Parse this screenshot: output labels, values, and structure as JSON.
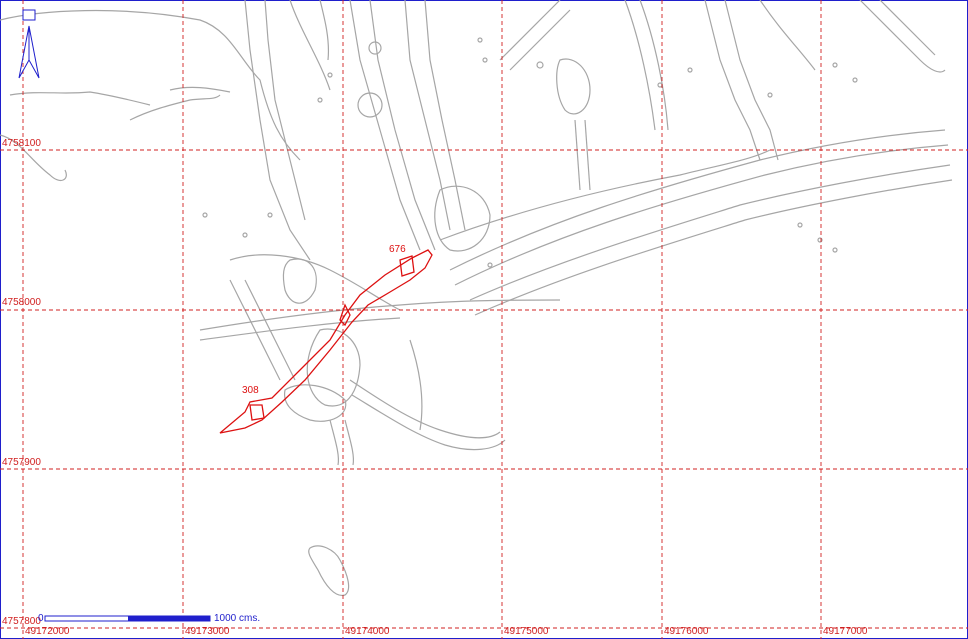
{
  "colors": {
    "grid": "#d02020",
    "feature": "#a6a6a6",
    "highlight": "#dd1111",
    "north_arrow": "#1f1fcc",
    "scale_bar": "#1f1fcc",
    "frame": "#1f1fcc"
  },
  "grid": {
    "y_labels": [
      "4758100",
      "4758000",
      "4757900",
      "4757800"
    ],
    "x_labels": [
      "49172000",
      "49173000",
      "49174000",
      "49175000",
      "49176000",
      "49177000"
    ]
  },
  "highlight": {
    "labels": [
      "676",
      "308"
    ]
  },
  "scale_bar": {
    "start_label": "0",
    "end_label": "1000 cms."
  },
  "icons": {
    "north_arrow": "north-arrow-icon"
  }
}
